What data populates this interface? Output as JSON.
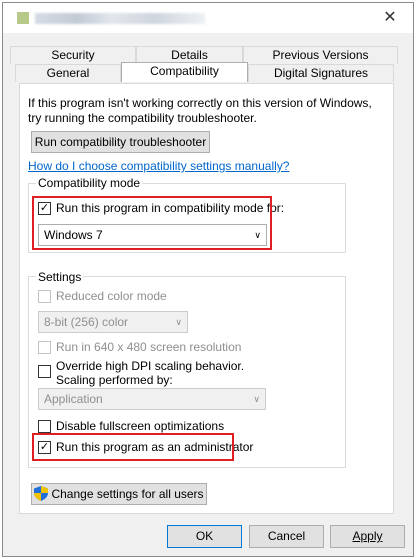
{
  "window": {
    "close_glyph": "✕"
  },
  "tabs": {
    "row1": [
      "Security",
      "Details",
      "Previous Versions"
    ],
    "row2": [
      "General",
      "Compatibility",
      "Digital Signatures"
    ]
  },
  "intro": {
    "line1": "If this program isn't working correctly on this version of Windows,",
    "line2": "try running the compatibility troubleshooter."
  },
  "troubleshooter_button": "Run compatibility troubleshooter",
  "manual_link": "How do I choose compatibility settings manually?",
  "compat_mode": {
    "group_label": "Compatibility mode",
    "checkbox_label": "Run this program in compatibility mode for:",
    "checked": true,
    "selected_os": "Windows 7"
  },
  "settings": {
    "group_label": "Settings",
    "reduced_color": {
      "label": "Reduced color mode",
      "checked": false,
      "enabled": false
    },
    "color_select": "8-bit (256) color",
    "res640": {
      "label": "Run in 640 x 480 screen resolution",
      "checked": false,
      "enabled": false
    },
    "dpi_override": {
      "line1": "Override high DPI scaling behavior.",
      "line2": "Scaling performed by:",
      "checked": false
    },
    "dpi_select": "Application",
    "fullscreen": {
      "label": "Disable fullscreen optimizations",
      "checked": false
    },
    "admin": {
      "label": "Run this program as an administrator",
      "checked": true
    }
  },
  "all_users_button": "Change settings for all users",
  "footer": {
    "ok": "OK",
    "cancel": "Cancel",
    "apply": "Apply"
  },
  "colors": {
    "highlight": "#e02020",
    "link": "#0066cc",
    "shield_blue": "#1e6fd9",
    "shield_yellow": "#f2c200"
  },
  "icons": [
    "app-icon",
    "close-icon",
    "checkmark-icon",
    "chevron-down-icon",
    "uac-shield-icon"
  ]
}
